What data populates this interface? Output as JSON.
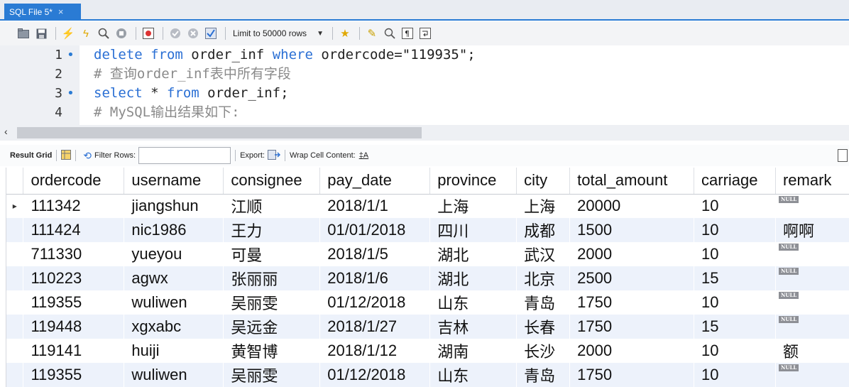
{
  "tab": {
    "title": "SQL File 5*",
    "close": "×"
  },
  "toolbar": {
    "limit_label": "Limit to 50000 rows",
    "icons": [
      "folder-open-icon",
      "save-icon",
      "execute-icon",
      "execute-current-icon",
      "find-icon",
      "stop-icon",
      "toggle-continue-icon",
      "commit-icon",
      "rollback-icon",
      "autocommit-icon",
      "limit-rows-select",
      "add-to-favorites-icon",
      "beautify-icon",
      "search-icon",
      "invisible-chars-icon",
      "wrap-icon"
    ]
  },
  "editor": {
    "lines": [
      {
        "num": "1",
        "dot": true,
        "parts": [
          {
            "t": "delete",
            "c": "kw"
          },
          {
            "t": " ",
            "c": ""
          },
          {
            "t": "from",
            "c": "kw"
          },
          {
            "t": " order_inf ",
            "c": ""
          },
          {
            "t": "where",
            "c": "kw"
          },
          {
            "t": " ordercode=",
            "c": ""
          },
          {
            "t": "\"119935\"",
            "c": "str"
          },
          {
            "t": ";",
            "c": ""
          }
        ]
      },
      {
        "num": "2",
        "dot": false,
        "parts": [
          {
            "t": "# 查询order_inf表中所有字段",
            "c": "cmt"
          }
        ]
      },
      {
        "num": "3",
        "dot": true,
        "parts": [
          {
            "t": "select",
            "c": "kw"
          },
          {
            "t": " * ",
            "c": ""
          },
          {
            "t": "from",
            "c": "kw"
          },
          {
            "t": " order_inf;",
            "c": ""
          }
        ]
      },
      {
        "num": "4",
        "dot": false,
        "parts": [
          {
            "t": "# MySQL输出结果如下:",
            "c": "cmt"
          }
        ]
      }
    ]
  },
  "result_toolbar": {
    "result_grid": "Result Grid",
    "filter_label": "Filter Rows:",
    "filter_value": "",
    "export_label": "Export:",
    "wrap_label": "Wrap Cell Content:"
  },
  "grid": {
    "columns": [
      "ordercode",
      "username",
      "consignee",
      "pay_date",
      "province",
      "city",
      "total_amount",
      "carriage",
      "remark"
    ],
    "null_text": "NULL",
    "rows": [
      {
        "ordercode": "111342",
        "username": "jiangshun",
        "consignee": "江顺",
        "pay_date": "2018/1/1",
        "province": "上海",
        "city": "上海",
        "total_amount": "20000",
        "carriage": "10",
        "remark": null,
        "current": true
      },
      {
        "ordercode": "111424",
        "username": "nic1986",
        "consignee": "王力",
        "pay_date": "01/01/2018",
        "province": "四川",
        "city": "成都",
        "total_amount": "1500",
        "carriage": "10",
        "remark": "啊啊"
      },
      {
        "ordercode": "711330",
        "username": "yueyou",
        "consignee": "可曼",
        "pay_date": "2018/1/5",
        "province": "湖北",
        "city": "武汉",
        "total_amount": "2000",
        "carriage": "10",
        "remark": null
      },
      {
        "ordercode": "110223",
        "username": "agwx",
        "consignee": "张丽丽",
        "pay_date": "2018/1/6",
        "province": "湖北",
        "city": "北京",
        "total_amount": "2500",
        "carriage": "15",
        "remark": null
      },
      {
        "ordercode": "119355",
        "username": "wuliwen",
        "consignee": "吴丽雯",
        "pay_date": "01/12/2018",
        "province": "山东",
        "city": "青岛",
        "total_amount": "1750",
        "carriage": "10",
        "remark": null
      },
      {
        "ordercode": "119448",
        "username": "xgxabc",
        "consignee": "吴远金",
        "pay_date": "2018/1/27",
        "province": "吉林",
        "city": "长春",
        "total_amount": "1750",
        "carriage": "15",
        "remark": null
      },
      {
        "ordercode": "119141",
        "username": "huiji",
        "consignee": "黄智博",
        "pay_date": "2018/1/12",
        "province": "湖南",
        "city": "长沙",
        "total_amount": "2000",
        "carriage": "10",
        "remark": "额"
      },
      {
        "ordercode": "119355",
        "username": "wuliwen",
        "consignee": "吴丽雯",
        "pay_date": "01/12/2018",
        "province": "山东",
        "city": "青岛",
        "total_amount": "1750",
        "carriage": "10",
        "remark": null
      }
    ]
  }
}
